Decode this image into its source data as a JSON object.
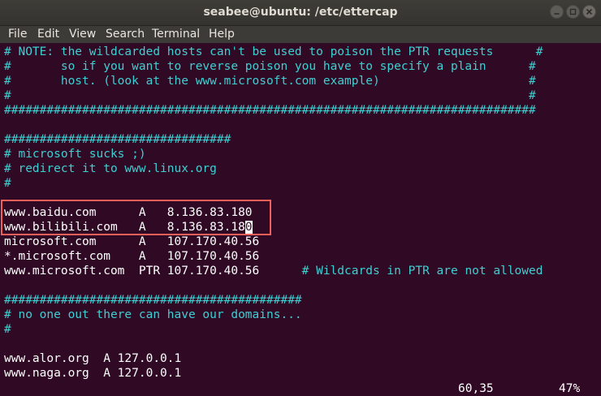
{
  "window": {
    "title": "seabee@ubuntu: /etc/ettercap"
  },
  "menu": [
    "File",
    "Edit",
    "View",
    "Search",
    "Terminal",
    "Help"
  ],
  "lines": [
    {
      "text": "# NOTE: the wildcarded hosts can't be used to poison the PTR requests      #",
      "type": "comment"
    },
    {
      "text": "#       so if you want to reverse poison you have to specify a plain      #",
      "type": "comment"
    },
    {
      "text": "#       host. (look at the www.microsoft.com example)                     #",
      "type": "comment"
    },
    {
      "text": "#                                                                         #",
      "type": "comment"
    },
    {
      "text": "###########################################################################",
      "type": "comment"
    },
    {
      "text": "",
      "type": "blank"
    },
    {
      "text": "################################",
      "type": "comment"
    },
    {
      "text": "# microsoft sucks ;)",
      "type": "comment"
    },
    {
      "text": "# redirect it to www.linux.org",
      "type": "comment"
    },
    {
      "text": "#",
      "type": "comment"
    },
    {
      "text": "",
      "type": "blank"
    },
    {
      "text": "www.baidu.com      A   8.136.83.180",
      "type": "plain"
    },
    {
      "text": "www.bilibili.com   A   8.136.83.180",
      "type": "plain"
    },
    {
      "text": "microsoft.com      A   107.170.40.56",
      "type": "plain"
    },
    {
      "text": "*.microsoft.com    A   107.170.40.56",
      "type": "plain"
    },
    {
      "text": "www.microsoft.com  PTR 107.170.40.56",
      "type": "plain",
      "trailing_comment": "      # Wildcards in PTR are not allowed"
    },
    {
      "text": "",
      "type": "blank"
    },
    {
      "text": "##########################################",
      "type": "comment"
    },
    {
      "text": "# no one out there can have our domains...",
      "type": "comment"
    },
    {
      "text": "#",
      "type": "comment"
    },
    {
      "text": "",
      "type": "blank"
    },
    {
      "text": "www.alor.org  A 127.0.0.1",
      "type": "plain"
    },
    {
      "text": "www.naga.org  A 127.0.0.1",
      "type": "plain"
    }
  ],
  "cursor_line": {
    "before": "www.bilibili.com   A   8.136.83.18",
    "cursor_char": "0",
    "after": ""
  },
  "status": {
    "position": "60,35",
    "percent": "47%"
  },
  "colors": {
    "background": "#300a24",
    "comment": "#3ecfd2",
    "text": "#ffffff",
    "highlight_box": "#f0605a"
  }
}
